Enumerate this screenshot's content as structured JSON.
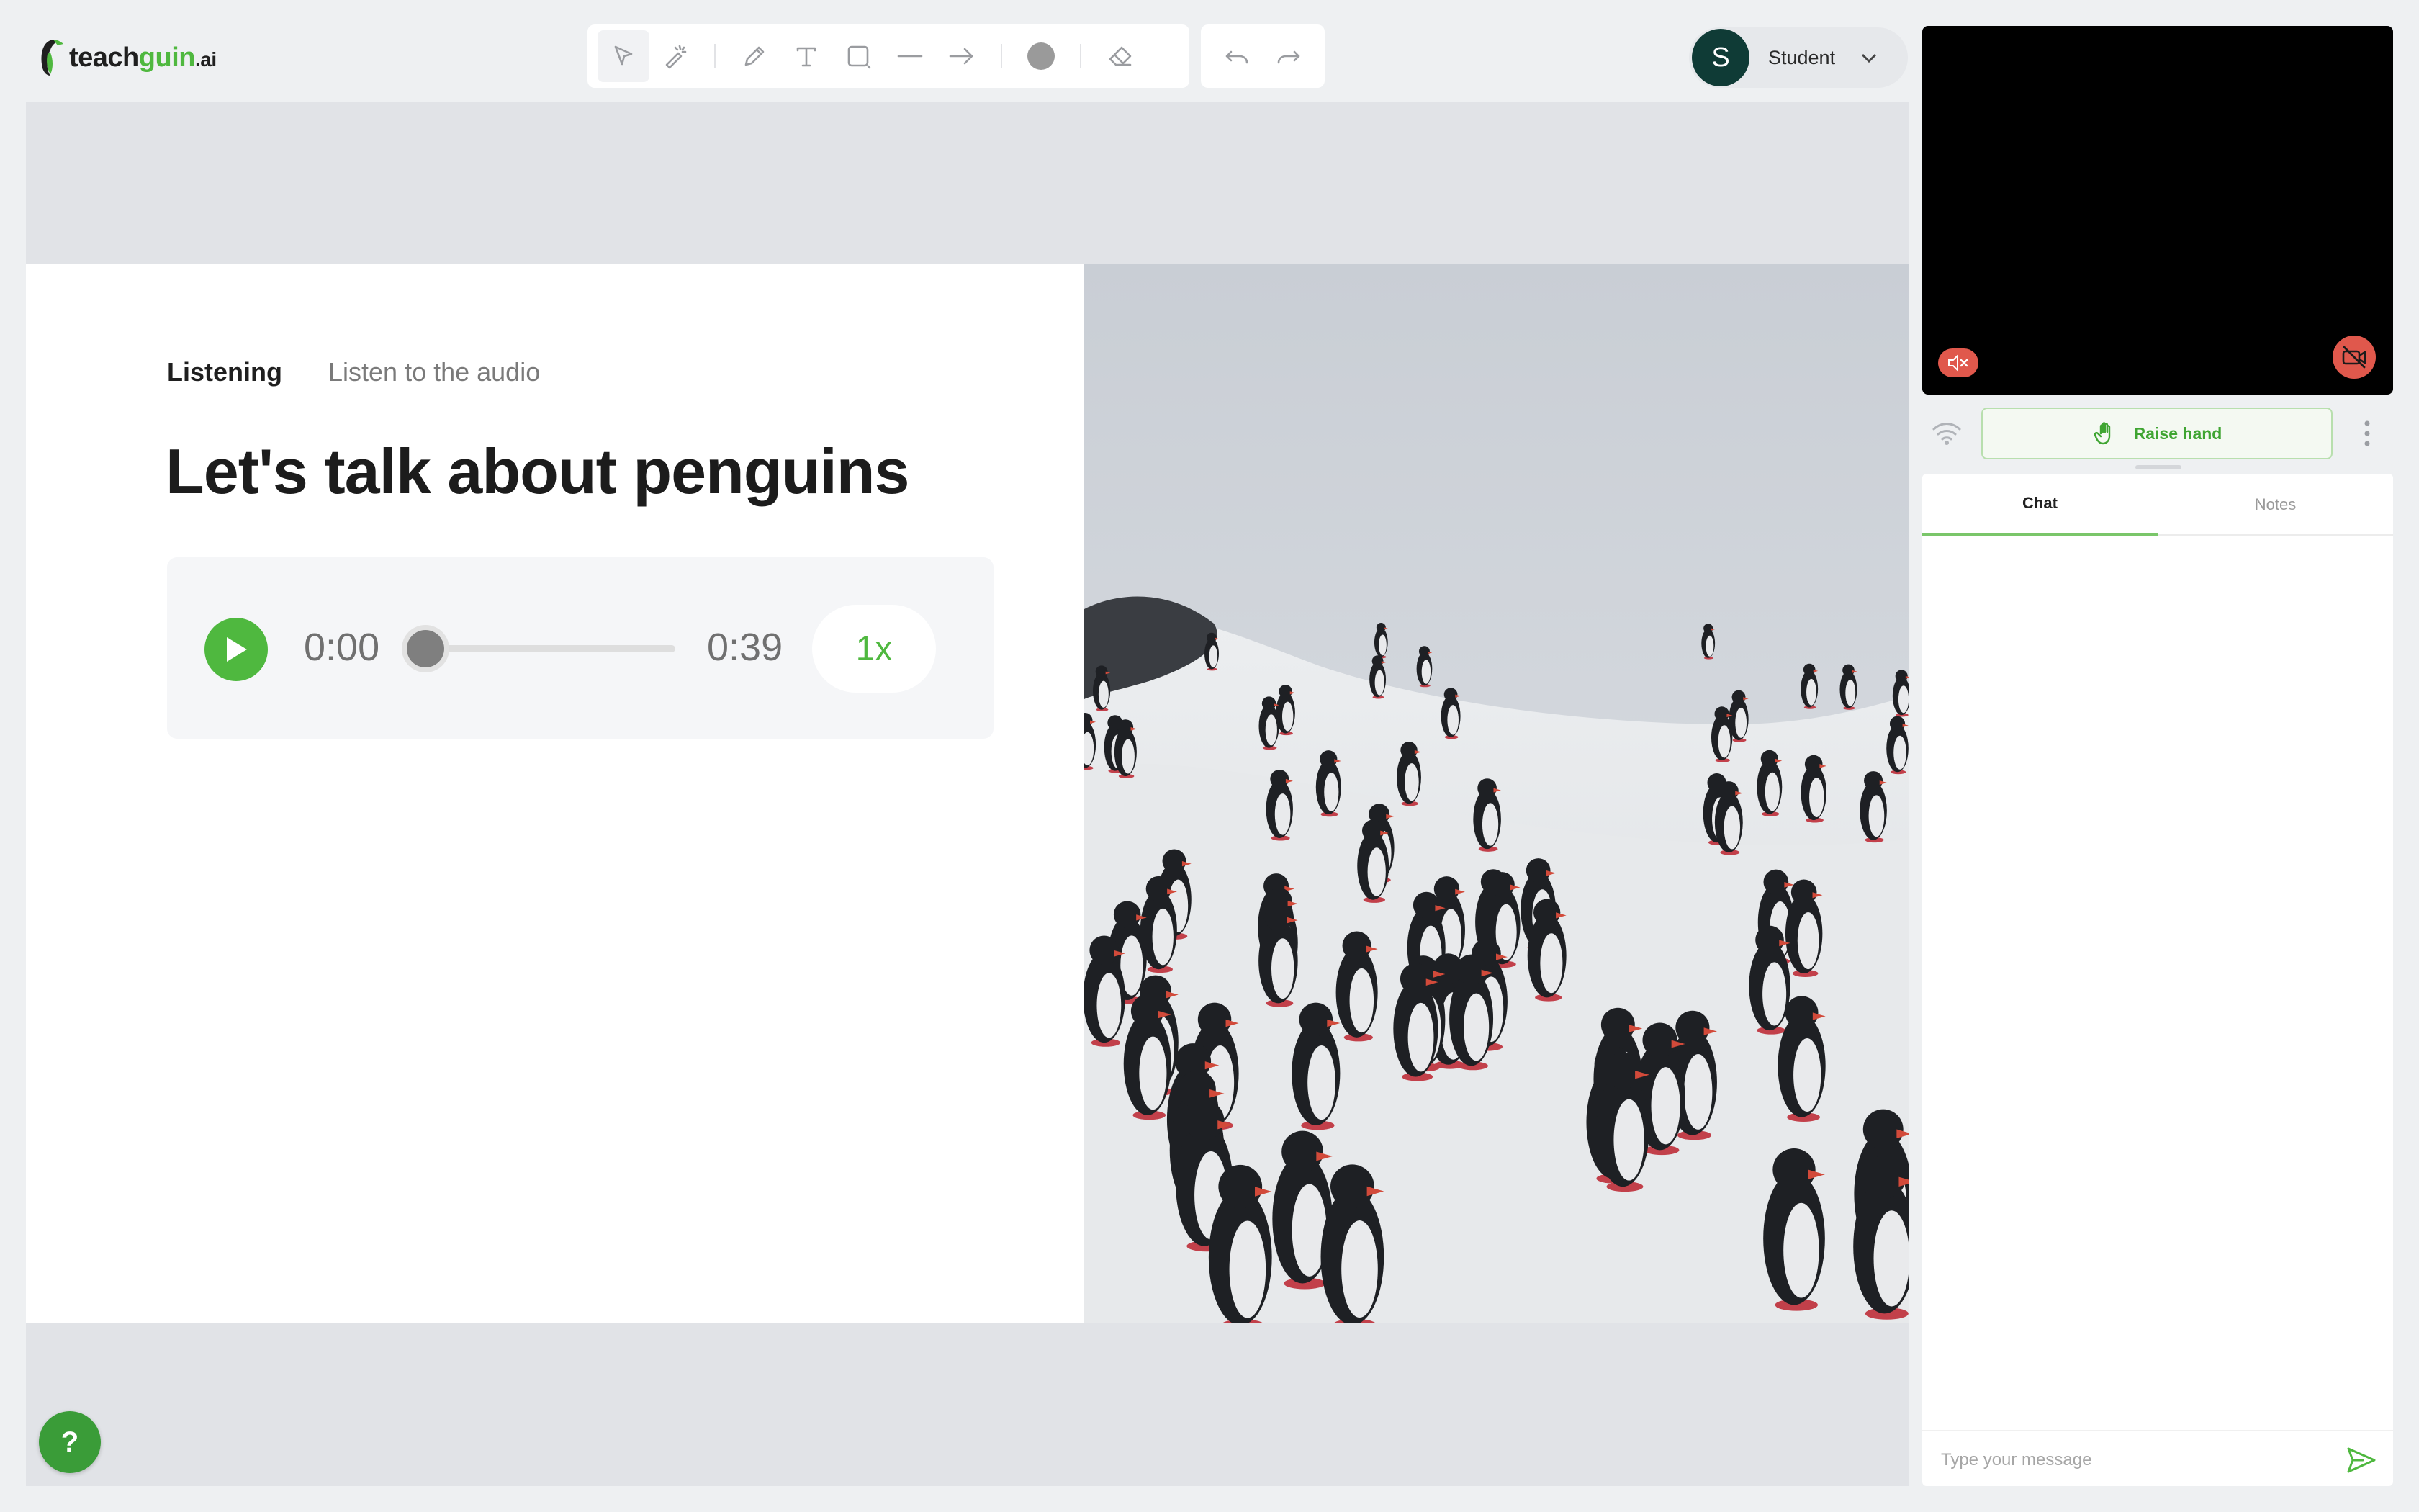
{
  "logo": {
    "part1": "teach",
    "part2": "guin",
    "part3": ".ai"
  },
  "toolbar": {
    "tools": [
      "select-tool",
      "magic-tool",
      "pen-tool",
      "text-tool",
      "shape-tool",
      "line-tool",
      "arrow-tool",
      "color-picker",
      "eraser-tool"
    ],
    "history": [
      "undo",
      "redo"
    ]
  },
  "user": {
    "initial": "S",
    "role": "Student"
  },
  "slide": {
    "tag": "Listening",
    "instruction": "Listen to the audio",
    "title": "Let's talk about penguins",
    "image": "penguins-on-snowy-hill"
  },
  "audio": {
    "current": "0:00",
    "total": "0:39",
    "speed": "1x",
    "progress": 0
  },
  "help": {
    "label": "?"
  },
  "video": {
    "mic": "muted",
    "camera": "off"
  },
  "controls": {
    "raise_hand": "Raise hand"
  },
  "chat": {
    "tabs": [
      "Chat",
      "Notes"
    ],
    "active_tab": "Chat",
    "placeholder": "Type your message"
  },
  "colors": {
    "brand": "#4fb83f",
    "danger": "#e0584c",
    "avatar": "#0f3b36"
  }
}
